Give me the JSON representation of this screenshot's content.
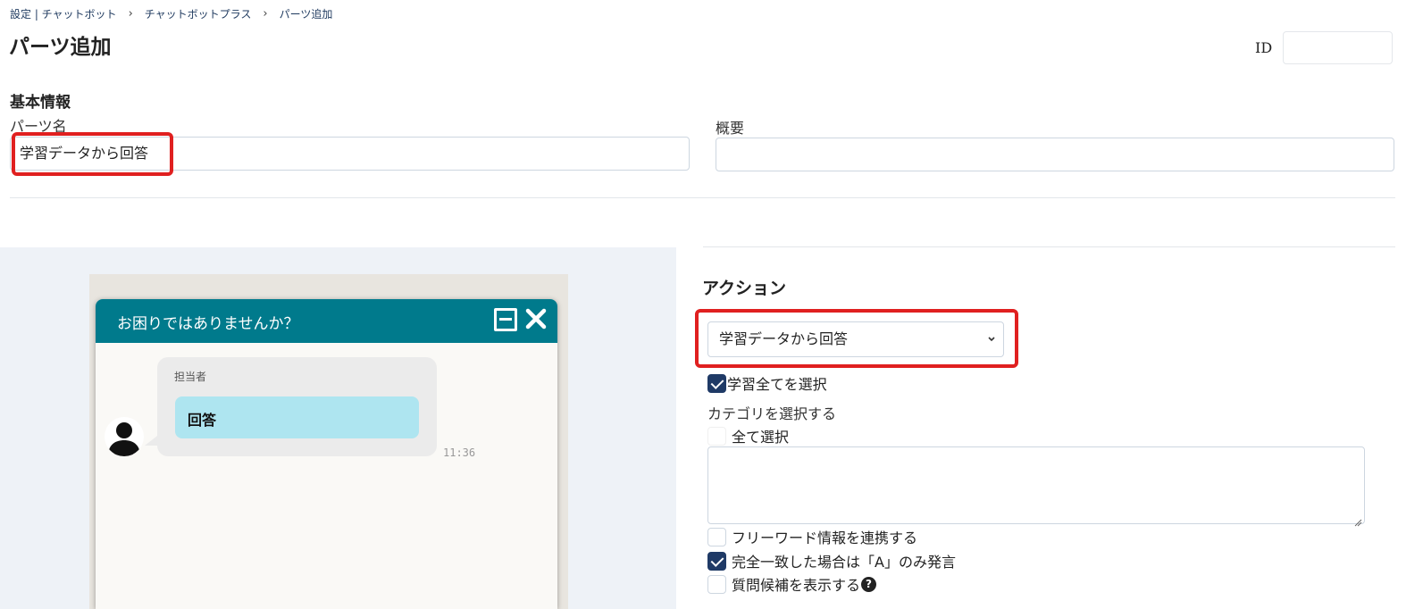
{
  "breadcrumb": {
    "items": [
      "設定 | チャットボット",
      "チャットボットプラス",
      "パーツ追加"
    ],
    "separator": "›"
  },
  "page_title": "パーツ追加",
  "id_field": {
    "label": "ID",
    "value": ""
  },
  "basic_info": {
    "title": "基本情報",
    "part_name_label": "パーツ名",
    "part_name_value": "学習データから回答",
    "summary_label": "概要",
    "summary_value": ""
  },
  "preview": {
    "chat_title": "お困りではありませんか？",
    "sender": "担当者",
    "answer_button": "回答",
    "timestamp": "11:36",
    "header_color": "#007a8c",
    "answer_color": "#aee5f0"
  },
  "action": {
    "title": "アクション",
    "selected": "学習データから回答",
    "select_all_learning": {
      "label": "学習全てを選択",
      "checked": true
    },
    "category_label": "カテゴリを選択する",
    "select_all": {
      "label": "全て選択",
      "checked": false
    },
    "freeword": {
      "label": "フリーワード情報を連携する",
      "checked": false
    },
    "exact_match": {
      "label": "完全一致した場合は「A」のみ発言",
      "checked": true
    },
    "show_candidates": {
      "label": "質問候補を表示する",
      "checked": false
    }
  },
  "icons": {
    "minimize": "minimize-icon",
    "close": "close-icon",
    "avatar": "user-avatar-icon",
    "help": "question-circle-icon",
    "select_caret": "chevron-down-icon"
  },
  "colors": {
    "highlight": "#e02020",
    "checkbox_checked": "#1f3a66"
  }
}
